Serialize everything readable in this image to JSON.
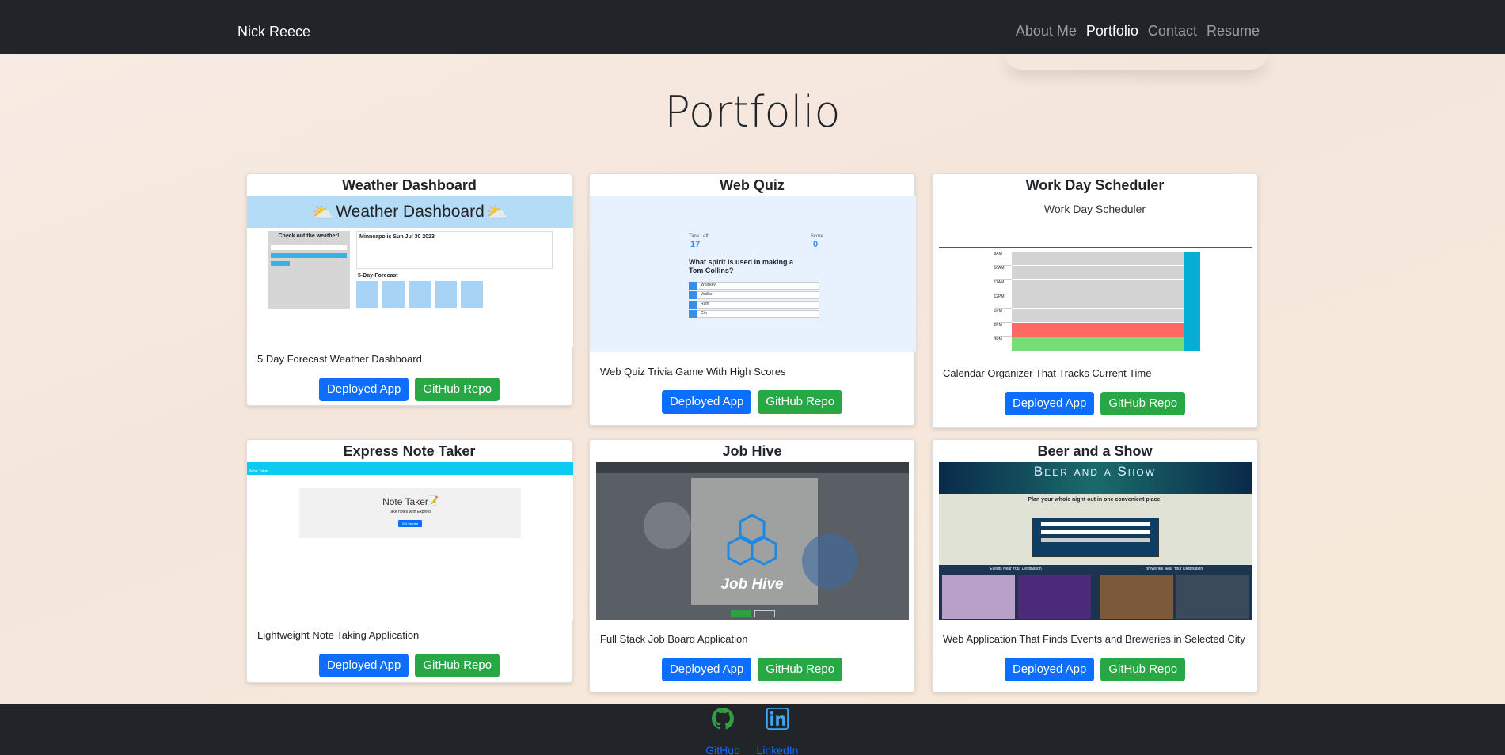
{
  "nav": {
    "brand": "Nick Reece",
    "links": [
      "About Me",
      "Portfolio",
      "Contact",
      "Resume"
    ]
  },
  "page_title": "Portfolio",
  "buttons": {
    "deployed": "Deployed App",
    "repo": "GitHub Repo"
  },
  "projects": [
    {
      "title": "Weather Dashboard",
      "description": "5 Day Forecast Weather Dashboard",
      "shot": {
        "banner": "Weather Dashboard",
        "side_heading": "Check out the weather!",
        "city_line": "Minneapolis Sun Jul 30 2023",
        "forecast_heading": "5-Day-Forecast"
      }
    },
    {
      "title": "Web Quiz",
      "description": "Web Quiz Trivia Game With High Scores",
      "shot": {
        "time_label": "Time Left",
        "time_value": "17",
        "score_label": "Score",
        "score_value": "0",
        "question": "What spirit is used in making a Tom Collins?",
        "answers": [
          "Whiskey",
          "Vodka",
          "Rum",
          "Gin"
        ]
      }
    },
    {
      "title": "Work Day Scheduler",
      "description": "Calendar Organizer That Tracks Current Time",
      "shot": {
        "heading": "Work Day Scheduler",
        "hours": [
          "9AM",
          "10AM",
          "11AM",
          "12PM",
          "1PM",
          "2PM",
          "3PM"
        ]
      }
    },
    {
      "title": "Express Note Taker",
      "description": "Lightweight Note Taking Application",
      "shot": {
        "bar": "Note Taker",
        "heading": "Note Taker",
        "sub": "Take notes with Express",
        "button": "Get Started"
      }
    },
    {
      "title": "Job Hive",
      "description": "Full Stack Job Board Application",
      "shot": {
        "logo_text": "Job Hive"
      }
    },
    {
      "title": "Beer and a Show",
      "description": "Web Application That Finds Events and Breweries in Selected City",
      "shot": {
        "banner": "Beer and a Show",
        "tagline": "Plan your whole night out in one convenient place!",
        "events_heading": "Events Near Your Destination",
        "breweries_heading": "Breweries Near Your Destination"
      }
    }
  ],
  "footer": {
    "github": "GitHub",
    "linkedin": "LinkedIn"
  },
  "colors": {
    "nav": "#212529",
    "primary": "#0d6efd",
    "success": "#28a745",
    "github_green": "#2ea043",
    "linkedin_blue": "#3fa9f5"
  }
}
